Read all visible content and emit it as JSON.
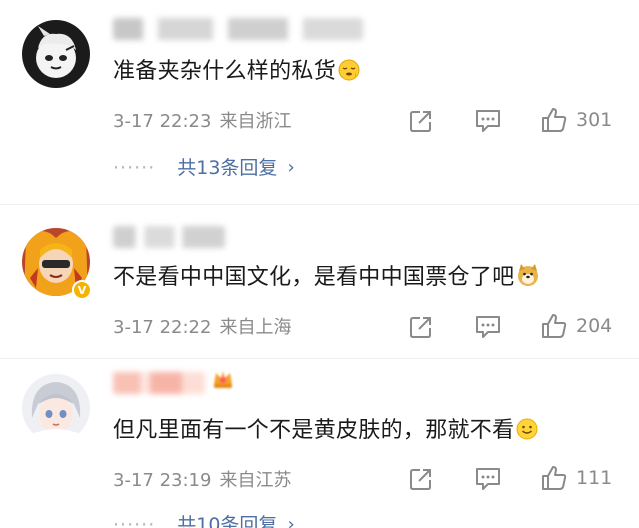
{
  "comments": [
    {
      "text": "准备夹杂什么样的私货",
      "emoji_icon": "sleepy-face-icon",
      "time": "3-17 22:23",
      "location": "来自浙江",
      "likes": "301",
      "replies_label": "共13条回复"
    },
    {
      "text": "不是看中中国文化，是看中中国票仓了吧",
      "emoji_icon": "doge-icon",
      "time": "3-17 22:22",
      "location": "来自上海",
      "likes": "204",
      "verified_badge": "V"
    },
    {
      "text": "但凡里面有一个不是黄皮肤的，那就不看",
      "emoji_icon": "smile-face-icon",
      "time": "3-17 23:19",
      "location": "来自江苏",
      "likes": "111",
      "replies_label": "共10条回复"
    }
  ],
  "colors": {
    "link": "#4d6fa3",
    "meta": "#8a8a8a"
  }
}
